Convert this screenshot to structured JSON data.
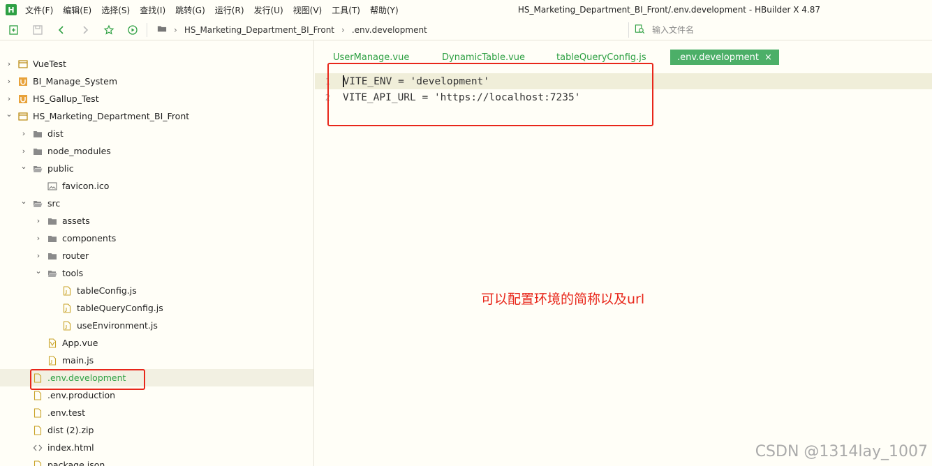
{
  "app": {
    "logo_letter": "H",
    "window_title": "HS_Marketing_Department_BI_Front/.env.development - HBuilder X 4.87",
    "accent_color": "#2ea043"
  },
  "menu": [
    "文件(F)",
    "编辑(E)",
    "选择(S)",
    "查找(I)",
    "跳转(G)",
    "运行(R)",
    "发行(U)",
    "视图(V)",
    "工具(T)",
    "帮助(Y)"
  ],
  "toolbar": {
    "breadcrumb": [
      "HS_Marketing_Department_BI_Front",
      ".env.development"
    ],
    "file_search_placeholder": "输入文件名"
  },
  "tree": [
    {
      "label": "VueTest",
      "icon": "project-icon",
      "chevron": "right"
    },
    {
      "label": "BI_Manage_System",
      "icon": "uni-project-icon",
      "chevron": "right"
    },
    {
      "label": "HS_Gallup_Test",
      "icon": "uni-project-icon",
      "chevron": "right"
    },
    {
      "label": "HS_Marketing_Department_BI_Front",
      "icon": "project-icon",
      "chevron": "down"
    },
    {
      "label": "dist",
      "icon": "folder-icon",
      "chevron": "right"
    },
    {
      "label": "node_modules",
      "icon": "folder-icon",
      "chevron": "right"
    },
    {
      "label": "public",
      "icon": "folder-open-icon",
      "chevron": "down"
    },
    {
      "label": "favicon.ico",
      "icon": "image-file-icon",
      "chevron": ""
    },
    {
      "label": "src",
      "icon": "folder-open-icon",
      "chevron": "down"
    },
    {
      "label": "assets",
      "icon": "folder-icon",
      "chevron": "right"
    },
    {
      "label": "components",
      "icon": "folder-icon",
      "chevron": "right"
    },
    {
      "label": "router",
      "icon": "folder-icon",
      "chevron": "right"
    },
    {
      "label": "tools",
      "icon": "folder-open-icon",
      "chevron": "down"
    },
    {
      "label": "tableConfig.js",
      "icon": "js-file-icon",
      "chevron": ""
    },
    {
      "label": "tableQueryConfig.js",
      "icon": "js-file-icon",
      "chevron": ""
    },
    {
      "label": "useEnvironment.js",
      "icon": "js-file-icon",
      "chevron": ""
    },
    {
      "label": "App.vue",
      "icon": "vue-file-icon",
      "chevron": ""
    },
    {
      "label": "main.js",
      "icon": "js-file-icon",
      "chevron": ""
    },
    {
      "label": ".env.development",
      "icon": "file-icon",
      "chevron": "",
      "active": true
    },
    {
      "label": ".env.production",
      "icon": "file-icon",
      "chevron": ""
    },
    {
      "label": ".env.test",
      "icon": "file-icon",
      "chevron": ""
    },
    {
      "label": "dist (2).zip",
      "icon": "file-icon",
      "chevron": ""
    },
    {
      "label": "index.html",
      "icon": "html-file-icon",
      "chevron": ""
    },
    {
      "label": "package.json",
      "icon": "file-icon",
      "chevron": ""
    }
  ],
  "tabs": [
    {
      "label": "UserManage.vue"
    },
    {
      "label": "DynamicTable.vue"
    },
    {
      "label": "tableQueryConfig.js"
    },
    {
      "label": ".env.development",
      "active": true
    }
  ],
  "tab_close_glyph": "×",
  "editor": {
    "lines": [
      {
        "num": "1",
        "text": "VITE_ENV = 'development'"
      },
      {
        "num": "2",
        "text": "VITE_API_URL = 'https://localhost:7235'"
      }
    ],
    "annotation": "可以配置环境的简称以及url",
    "annotation_color": "#e8261a"
  },
  "credit": "CSDN @1314lay_1007"
}
